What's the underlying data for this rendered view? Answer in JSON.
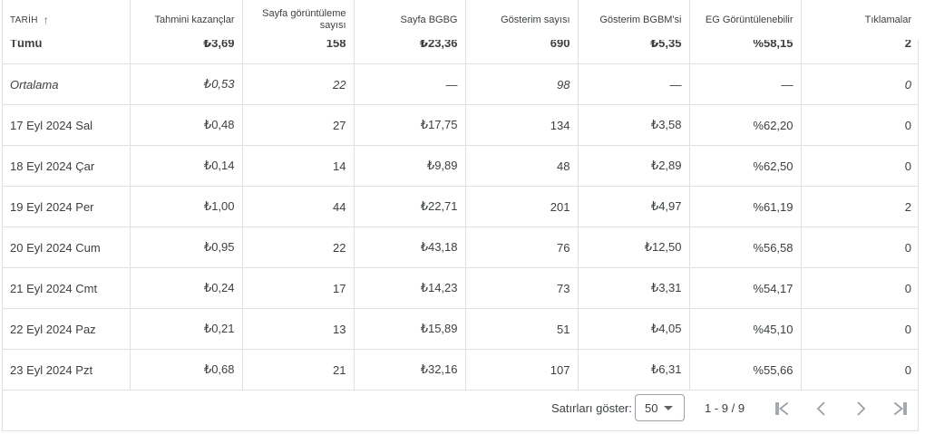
{
  "headers": {
    "date": "TARİH",
    "earnings": "Tahmini kazançlar",
    "pageviews": "Sayfa görüntüleme sayısı",
    "page_rpm": "Sayfa BGBG",
    "impressions": "Gösterim sayısı",
    "impression_rpm": "Gösterim BGBM'si",
    "viewable": "EG Görüntülenebilir",
    "clicks": "Tıklamalar"
  },
  "total": {
    "date": "Tümü",
    "earnings": "₺3,69",
    "pageviews": "158",
    "page_rpm": "₺23,36",
    "impressions": "690",
    "impression_rpm": "₺5,35",
    "viewable": "%58,15",
    "clicks": "2"
  },
  "average": {
    "date": "Ortalama",
    "earnings": "₺0,53",
    "pageviews": "22",
    "page_rpm": "—",
    "impressions": "98",
    "impression_rpm": "—",
    "viewable": "—",
    "clicks": "0"
  },
  "rows": [
    {
      "date": "17 Eyl 2024 Sal",
      "earnings": "₺0,48",
      "pageviews": "27",
      "page_rpm": "₺17,75",
      "impressions": "134",
      "impression_rpm": "₺3,58",
      "viewable": "%62,20",
      "clicks": "0"
    },
    {
      "date": "18 Eyl 2024 Çar",
      "earnings": "₺0,14",
      "pageviews": "14",
      "page_rpm": "₺9,89",
      "impressions": "48",
      "impression_rpm": "₺2,89",
      "viewable": "%62,50",
      "clicks": "0"
    },
    {
      "date": "19 Eyl 2024 Per",
      "earnings": "₺1,00",
      "pageviews": "44",
      "page_rpm": "₺22,71",
      "impressions": "201",
      "impression_rpm": "₺4,97",
      "viewable": "%61,19",
      "clicks": "2"
    },
    {
      "date": "20 Eyl 2024 Cum",
      "earnings": "₺0,95",
      "pageviews": "22",
      "page_rpm": "₺43,18",
      "impressions": "76",
      "impression_rpm": "₺12,50",
      "viewable": "%56,58",
      "clicks": "0"
    },
    {
      "date": "21 Eyl 2024 Cmt",
      "earnings": "₺0,24",
      "pageviews": "17",
      "page_rpm": "₺14,23",
      "impressions": "73",
      "impression_rpm": "₺3,31",
      "viewable": "%54,17",
      "clicks": "0"
    },
    {
      "date": "22 Eyl 2024 Paz",
      "earnings": "₺0,21",
      "pageviews": "13",
      "page_rpm": "₺15,89",
      "impressions": "51",
      "impression_rpm": "₺4,05",
      "viewable": "%45,10",
      "clicks": "0"
    },
    {
      "date": "23 Eyl 2024 Pzt",
      "earnings": "₺0,68",
      "pageviews": "21",
      "page_rpm": "₺32,16",
      "impressions": "107",
      "impression_rpm": "₺6,31",
      "viewable": "%55,66",
      "clicks": "0"
    }
  ],
  "footer": {
    "rows_label": "Satırları göster:",
    "rows_value": "50",
    "range": "1 - 9 / 9"
  },
  "icons": {
    "sort": "arrow-up-icon",
    "first": "first-page-icon",
    "prev": "chevron-left-icon",
    "next": "chevron-right-icon",
    "last": "last-page-icon"
  },
  "colors": {
    "border": "#e0e0e0",
    "text": "#3c4043",
    "icon_disabled": "#9aa0a6"
  }
}
